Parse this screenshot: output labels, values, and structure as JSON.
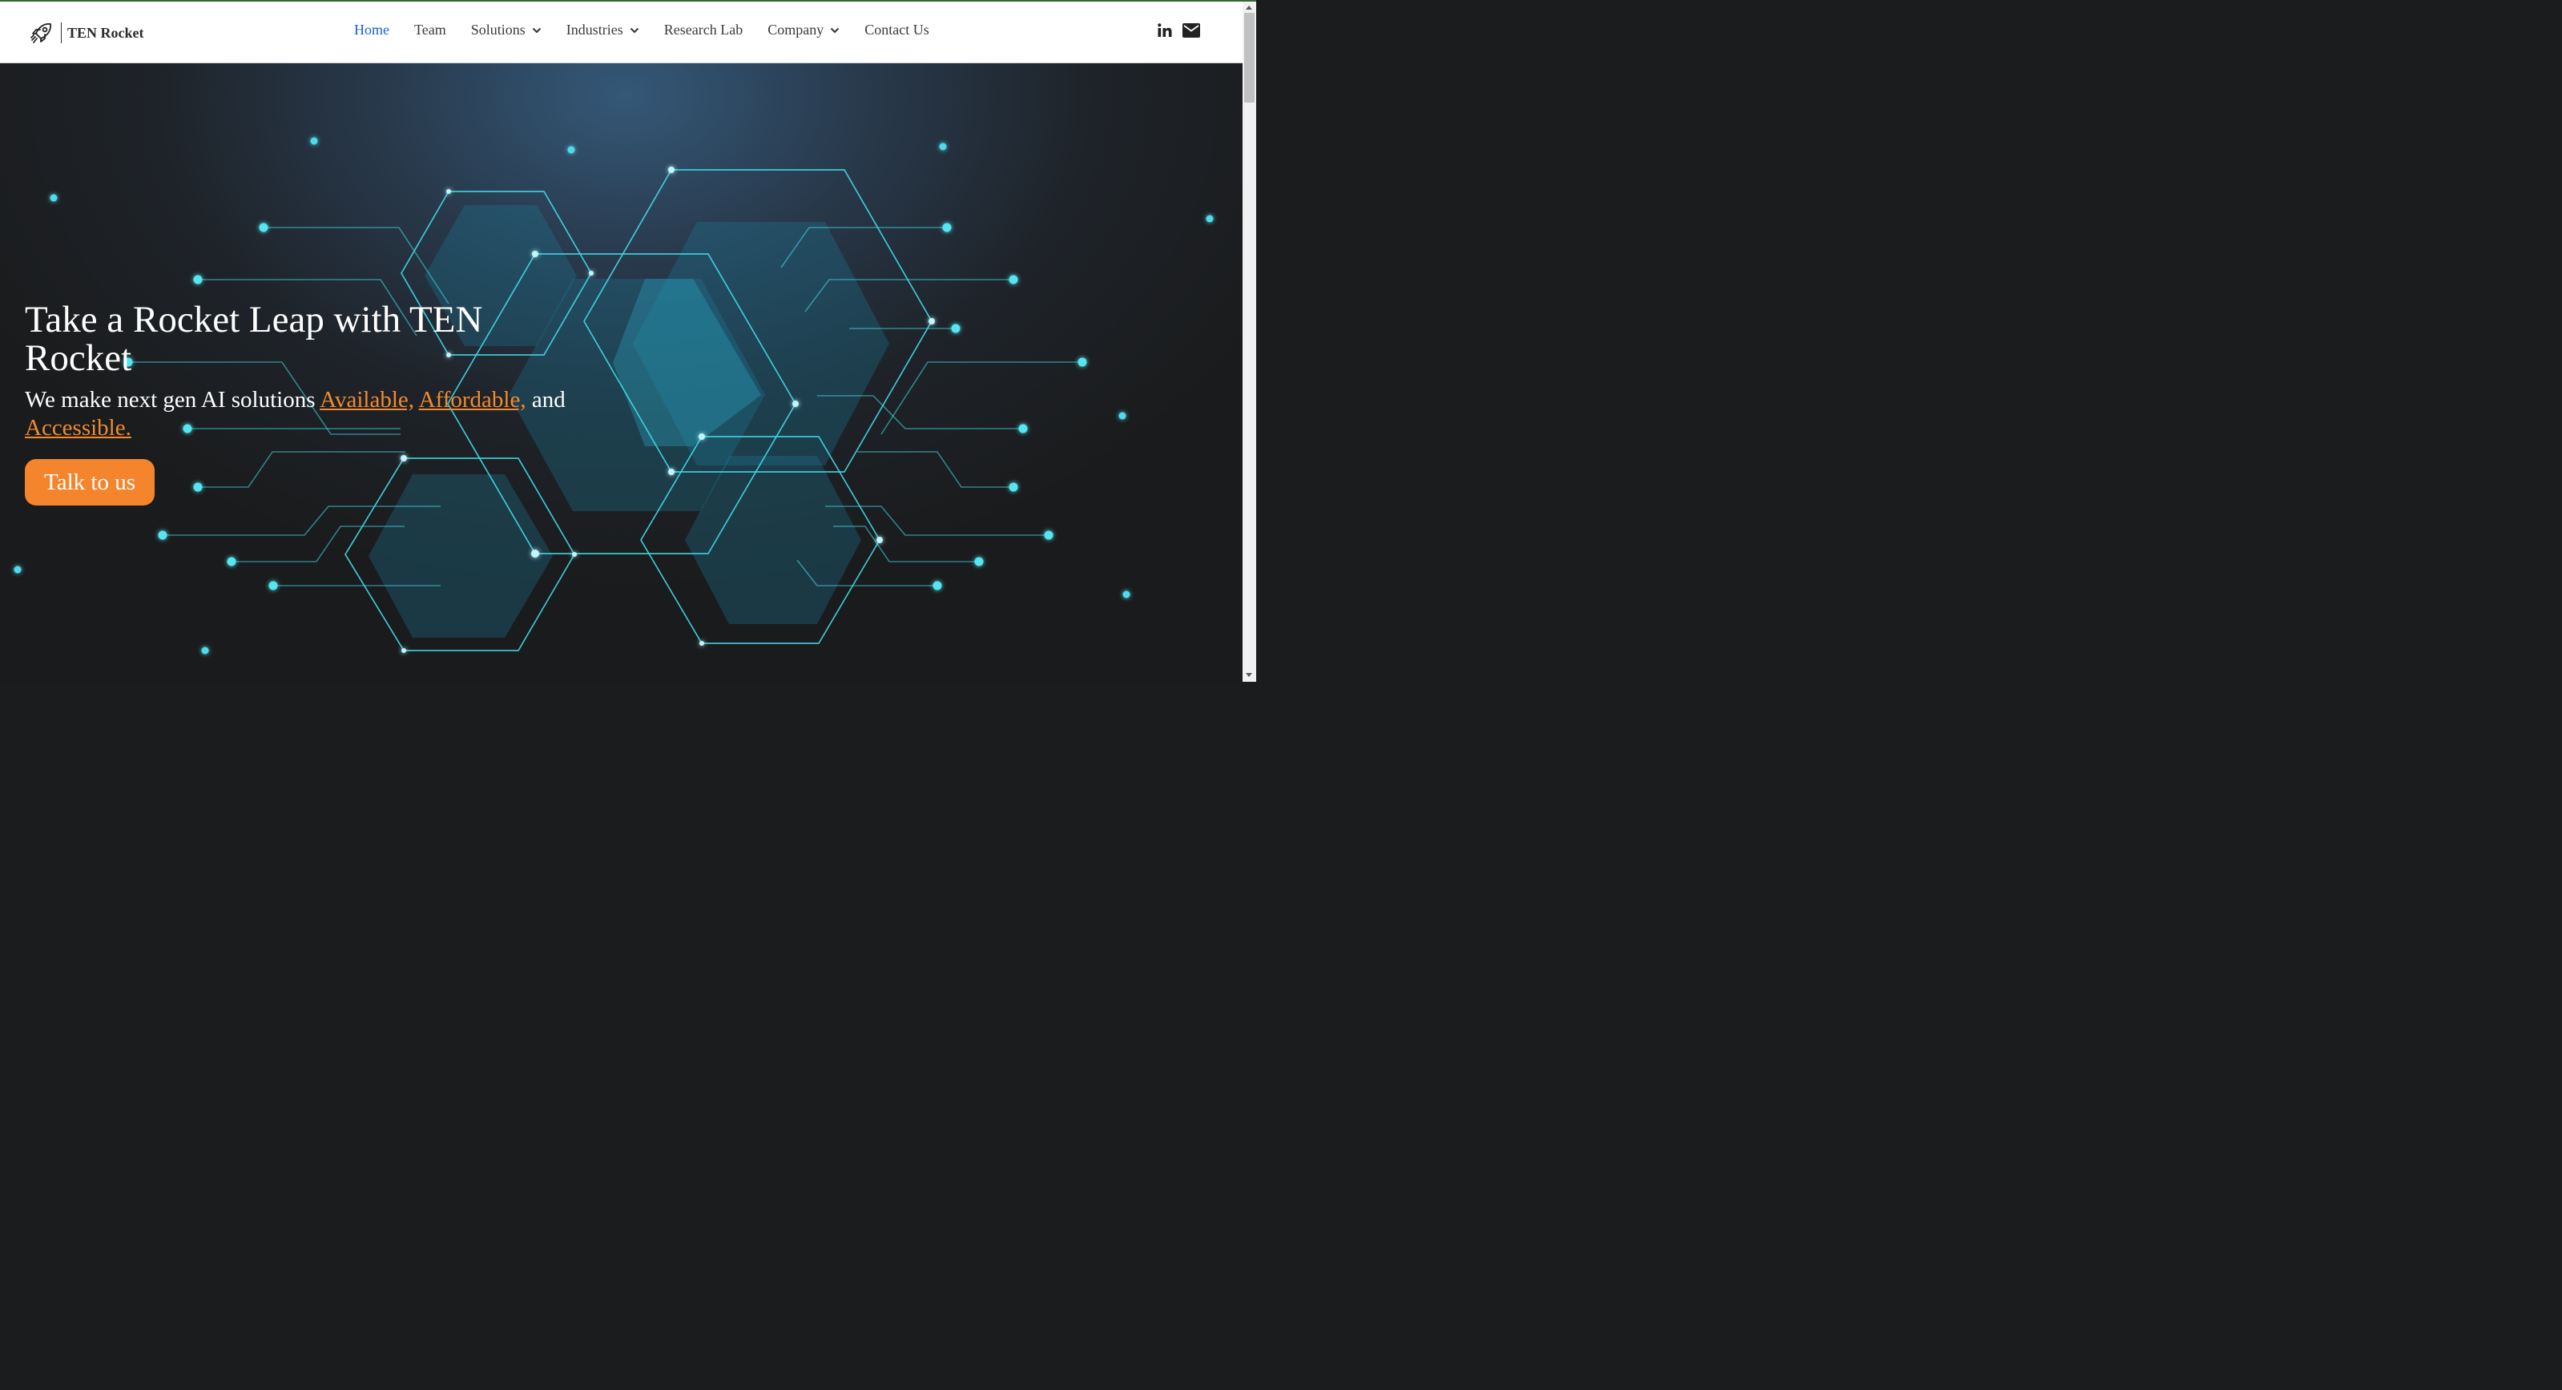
{
  "brand": {
    "name": "TEN Rocket"
  },
  "nav": {
    "home": "Home",
    "team": "Team",
    "solutions": "Solutions",
    "industries": "Industries",
    "research": "Research Lab",
    "company": "Company",
    "contact": "Contact Us",
    "active": "Home"
  },
  "social": {
    "icons": [
      "linkedin-icon",
      "mail-icon"
    ]
  },
  "hero": {
    "title": "Take a Rocket Leap with TEN Rocket",
    "subtitle_prefix": "We make next gen AI solutions ",
    "highlight_available": "Available,",
    "highlight_affordable": "Affordable,",
    "subtitle_mid": " and ",
    "highlight_accessible": "Accessible.",
    "cta": "Talk to us"
  },
  "colors": {
    "accent_orange": "#f5852c",
    "nav_active": "#1a5fd6",
    "circuit_cyan": "#3fd9e8",
    "hero_background": "#1a1c1e"
  }
}
